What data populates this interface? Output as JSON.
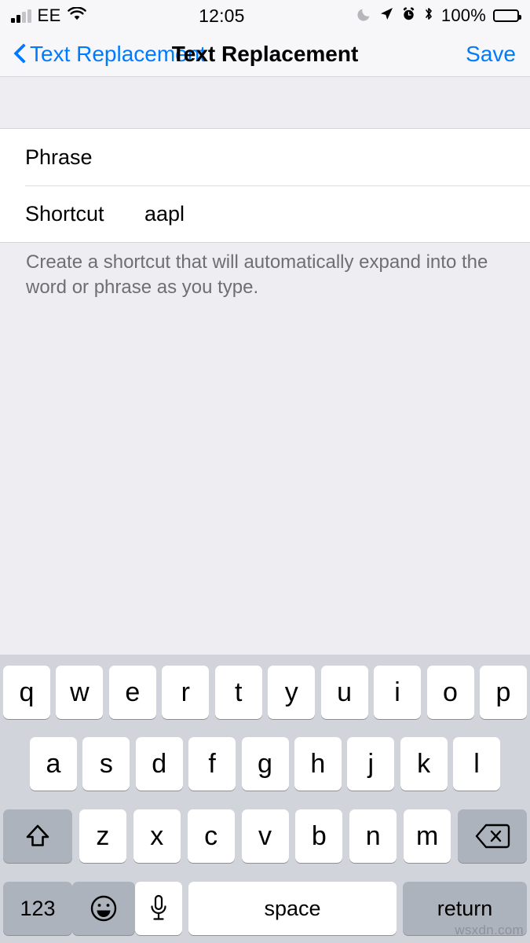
{
  "status_bar": {
    "carrier": "EE",
    "time": "12:05",
    "battery_percent": "100%",
    "signal_bars_active": 2,
    "signal_bars_total": 4,
    "icons": [
      "signal-bars",
      "wifi",
      "do-not-disturb-moon",
      "location-arrow",
      "alarm-clock",
      "bluetooth",
      "battery"
    ]
  },
  "nav_bar": {
    "back_label": "Text Replacement",
    "title": "Text Replacement",
    "save_label": "Save",
    "accent_color": "#007aff"
  },
  "form": {
    "rows": [
      {
        "label": "Phrase",
        "value": ""
      },
      {
        "label": "Shortcut",
        "value": "aapl"
      }
    ],
    "footer_note": "Create a shortcut that will automatically expand into the word or phrase as you type."
  },
  "keyboard": {
    "row1": [
      "q",
      "w",
      "e",
      "r",
      "t",
      "y",
      "u",
      "i",
      "o",
      "p"
    ],
    "row2": [
      "a",
      "s",
      "d",
      "f",
      "g",
      "h",
      "j",
      "k",
      "l"
    ],
    "row3_letters": [
      "z",
      "x",
      "c",
      "v",
      "b",
      "n",
      "m"
    ],
    "shift_label": "shift",
    "backspace_label": "delete",
    "numbers_label": "123",
    "emoji_label": "emoji",
    "dictation_label": "dictation",
    "space_label": "space",
    "return_label": "return"
  },
  "watermark": "wsxdn.com"
}
